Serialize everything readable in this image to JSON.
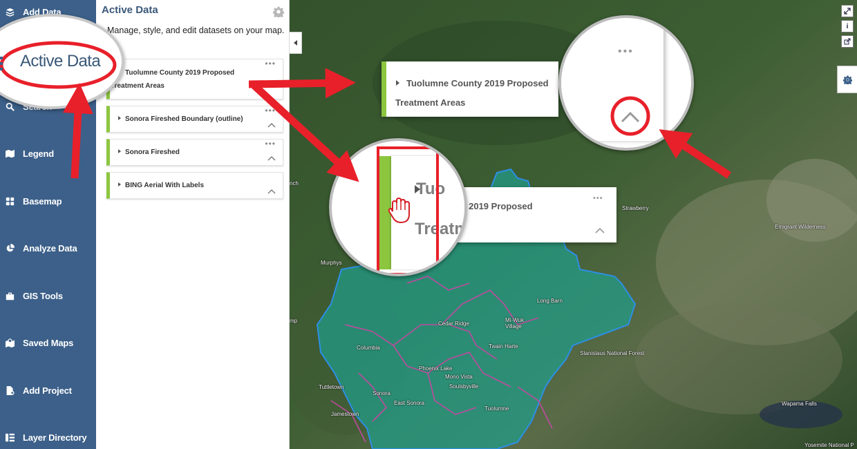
{
  "nav": {
    "items": [
      {
        "label": "Add Data",
        "icon": "layers-add-icon"
      },
      {
        "label": "Search",
        "icon": "search-icon"
      },
      {
        "label": "Legend",
        "icon": "map-legend-icon"
      },
      {
        "label": "Basemap",
        "icon": "grid-icon"
      },
      {
        "label": "Analyze Data",
        "icon": "pie-chart-icon"
      },
      {
        "label": "GIS Tools",
        "icon": "toolbox-icon"
      },
      {
        "label": "Saved Maps",
        "icon": "saved-maps-icon"
      },
      {
        "label": "Add Project",
        "icon": "add-file-icon"
      },
      {
        "label": "Layer Directory",
        "icon": "directory-icon"
      }
    ]
  },
  "panel": {
    "title": "Active Data",
    "subtitle": "Manage, style, and edit datasets on your map.",
    "layers": [
      {
        "line1": "Tuolumne County 2019 Proposed",
        "line2": "Treatment Areas",
        "color": "#8cc63f"
      },
      {
        "line1": "Sonora Fireshed Boundary (outline)",
        "line2": "",
        "color": "#8cc63f"
      },
      {
        "line1": "Sonora Fireshed",
        "line2": "",
        "color": "#8cc63f"
      },
      {
        "line1": "BING Aerial With Labels",
        "line2": "",
        "color": "#8cc63f"
      }
    ]
  },
  "callouts": {
    "active_data_zoom": "Active Data",
    "card_line1": "Tuolumne County 2019 Proposed",
    "card_line2": "Treatment Areas",
    "drag_card_text": "nty 2019 Proposed",
    "drag_zoom_text1": "Tuo",
    "drag_zoom_text2": "Treatm",
    "dots": "•••"
  },
  "map": {
    "labels": [
      "Strawberry",
      "Emigrant Wilderness",
      "Murphys",
      "Long Barn",
      "Cedar Ridge",
      "Mi-Wuk Village",
      "Twain Harte",
      "Columbia",
      "Stanislaus National Forest",
      "Phoenix Lake",
      "Mono Vista",
      "Soulsbyville",
      "Sonora",
      "East Sonora",
      "Tuttletown",
      "Jamestown",
      "Tuolumne",
      "Wapama Falls",
      "Yosemite National P",
      "nch",
      "mp"
    ],
    "buttons": {
      "info": "i"
    },
    "colors": {
      "fill": "#1fa08c",
      "outline": "#2d8fe6",
      "treatment": "#c04aa0",
      "arrow": "#e8202a"
    }
  }
}
